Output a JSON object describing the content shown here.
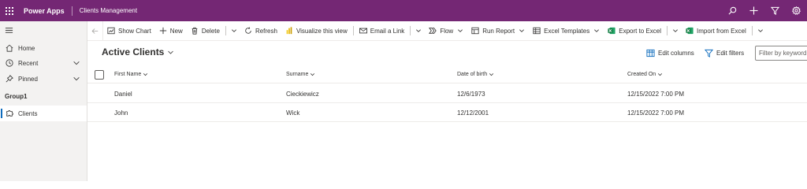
{
  "topbar": {
    "brand": "Power Apps",
    "app_title": "Clients Management",
    "icons": [
      "search-icon",
      "add-icon",
      "filter-icon",
      "settings-icon"
    ]
  },
  "sidebar": {
    "home": "Home",
    "recent": "Recent",
    "pinned": "Pinned",
    "group": "Group1",
    "clients": "Clients"
  },
  "commands": {
    "show_chart": "Show Chart",
    "new": "New",
    "delete": "Delete",
    "refresh": "Refresh",
    "visualize": "Visualize this view",
    "email_link": "Email a Link",
    "flow": "Flow",
    "run_report": "Run Report",
    "excel_templates": "Excel Templates",
    "export_excel": "Export to Excel",
    "import_excel": "Import from Excel"
  },
  "view": {
    "title": "Active Clients",
    "edit_columns": "Edit columns",
    "edit_filters": "Edit filters",
    "filter_placeholder": "Filter by keyword"
  },
  "grid": {
    "columns": [
      "First Name",
      "Surname",
      "Date of birth",
      "Created On"
    ],
    "rows": [
      [
        "Daniel",
        "Cieckiewicz",
        "12/6/1973",
        "12/15/2022 7:00 PM"
      ],
      [
        "John",
        "Wick",
        "12/12/2001",
        "12/15/2022 7:00 PM"
      ]
    ]
  },
  "colors": {
    "brand": "#742774",
    "accent": "#0f6cbd",
    "sidebar_bg": "#f3f2f1",
    "excel_green": "#107c41",
    "powerbi_yellow": "#f2c811"
  }
}
